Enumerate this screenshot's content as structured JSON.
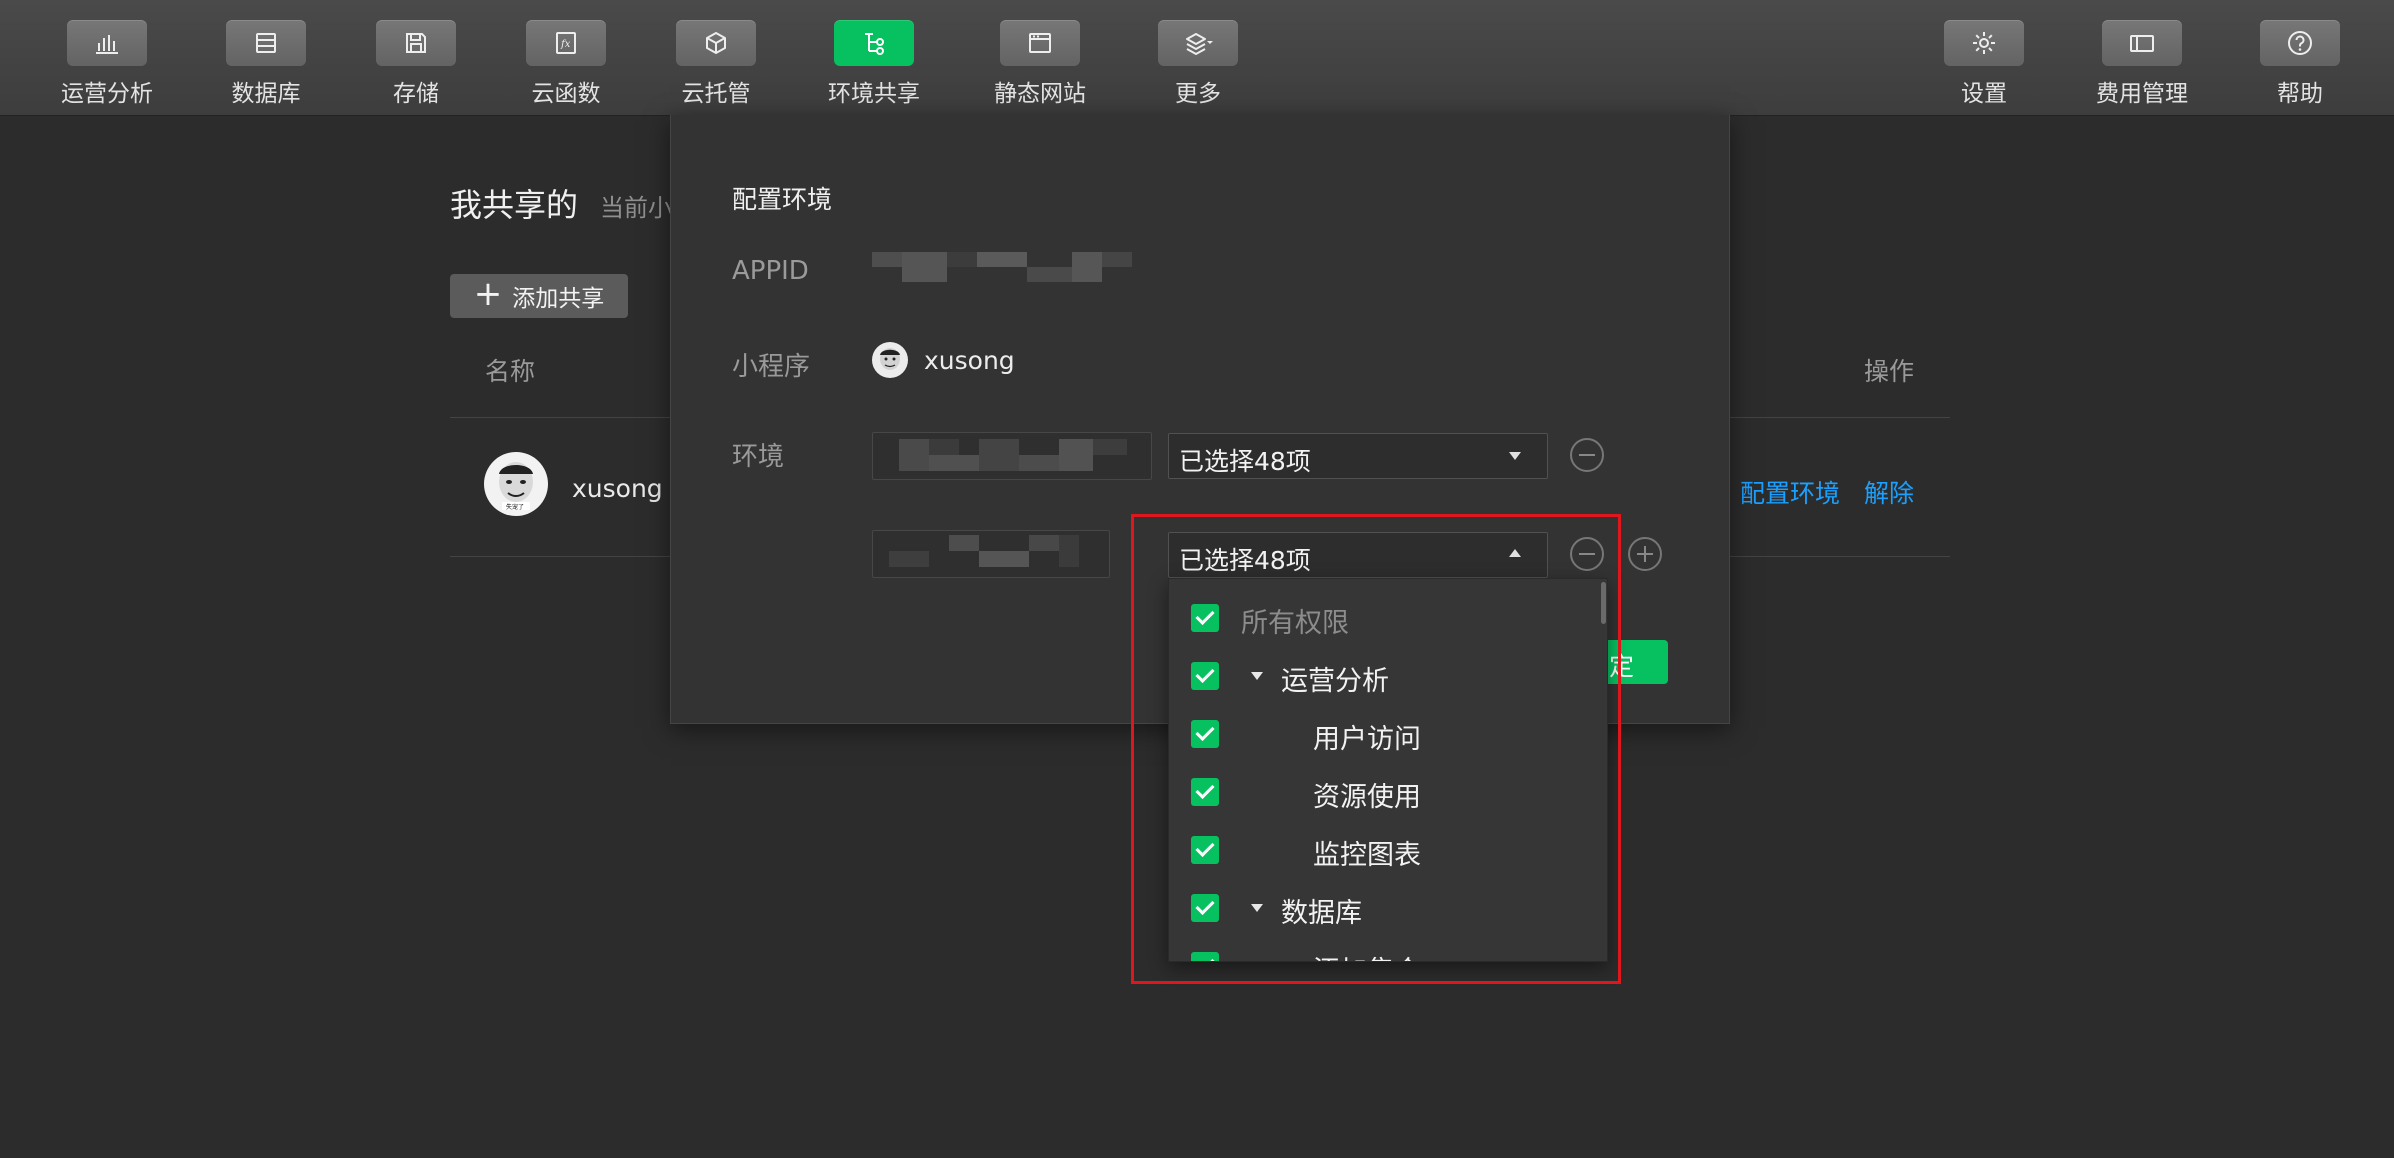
{
  "toolbar": {
    "left_items": [
      {
        "label": "运营分析",
        "icon": "bar-chart-icon"
      },
      {
        "label": "数据库",
        "icon": "database-icon"
      },
      {
        "label": "存储",
        "icon": "save-disk-icon"
      },
      {
        "label": "云函数",
        "icon": "function-fx-icon"
      },
      {
        "label": "云托管",
        "icon": "cube-icon"
      },
      {
        "label": "环境共享",
        "icon": "tree-share-icon",
        "active": true
      },
      {
        "label": "静态网站",
        "icon": "browser-window-icon"
      },
      {
        "label": "更多",
        "icon": "layers-icon"
      }
    ],
    "right_items": [
      {
        "label": "设置",
        "icon": "gear-icon"
      },
      {
        "label": "费用管理",
        "icon": "billing-card-icon"
      },
      {
        "label": "帮助",
        "icon": "question-icon"
      }
    ]
  },
  "page": {
    "title": "我共享的",
    "subtitle": "当前小程序",
    "add_button": "添加共享",
    "table": {
      "col_name": "名称",
      "col_ops": "操作",
      "rows": [
        {
          "name": "xusong",
          "config_link": "配置环境",
          "unbind_link": "解除"
        }
      ]
    }
  },
  "modal": {
    "title": "配置环境",
    "appid_label": "APPID",
    "miniprogram_label": "小程序",
    "miniprogram_name": "xusong",
    "env_label": "环境",
    "env_rows": [
      {
        "selected_text": "已选择48项",
        "open": false
      },
      {
        "selected_text": "已选择48项",
        "open": true
      }
    ],
    "confirm_button_partial": "确定"
  },
  "dropdown": {
    "items": [
      {
        "label": "所有权限",
        "checked": true,
        "level": 0,
        "muted": true
      },
      {
        "label": "运营分析",
        "checked": true,
        "level": 1,
        "group": true
      },
      {
        "label": "用户访问",
        "checked": true,
        "level": 2
      },
      {
        "label": "资源使用",
        "checked": true,
        "level": 2
      },
      {
        "label": "监控图表",
        "checked": true,
        "level": 2
      },
      {
        "label": "数据库",
        "checked": true,
        "level": 1,
        "group": true
      },
      {
        "label": "添加集合",
        "checked": true,
        "level": 2
      }
    ]
  },
  "colors": {
    "accent_green": "#07c160",
    "link_blue": "#1aa0ff",
    "highlight_red": "#e0161d"
  }
}
